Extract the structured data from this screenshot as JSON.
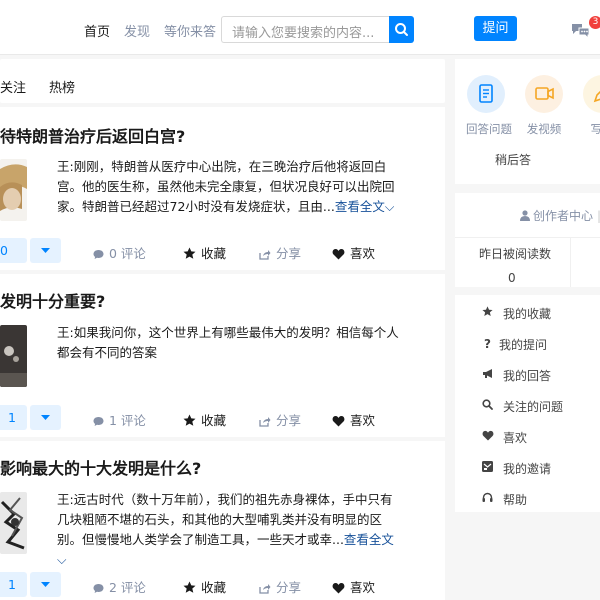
{
  "nav": {
    "links": [
      "首页",
      "发现",
      "等你来答"
    ],
    "search_placeholder": "请输入您要搜索的内容...",
    "ask_label": "提问",
    "message_count": "3"
  },
  "feed": {
    "tabs": [
      "关注",
      "热榜"
    ],
    "posts": [
      {
        "title": "待特朗普治疗后返回白宫?",
        "excerpt": "王:刚刚，特朗普从医疗中心出院，在三晚治疗后他将返回白宫。他的医生称，虽然他未完全康复，但状况良好可以出院回家。特朗普已经超过72小时没有发烧症状，且由...",
        "read_more": "查看全文",
        "vote": "0",
        "comments": "0 评论",
        "favorite": "收藏",
        "share": "分享",
        "like": "喜欢"
      },
      {
        "title": "发明十分重要?",
        "excerpt": "王:如果我问你，这个世界上有哪些最伟大的发明？相信每个人都会有不同的答案",
        "read_more": "",
        "vote": "1",
        "comments": "1 评论",
        "favorite": "收藏",
        "share": "分享",
        "like": "喜欢"
      },
      {
        "title": "影响最大的十大发明是什么?",
        "excerpt": "王:远古时代（数十万年前），我们的祖先赤身裸体，手中只有几块粗陋不堪的石头，和其他的大型哺乳类并没有明显的区别。但慢慢地人类学会了制造工具，一些天才或幸...",
        "read_more": "查看全文",
        "vote": "1",
        "comments": "2 评论",
        "favorite": "收藏",
        "share": "分享",
        "like": "喜欢"
      }
    ]
  },
  "sidebar": {
    "create": {
      "answer": "回答问题",
      "video": "发视频",
      "write": "写文",
      "later": "稍后答"
    },
    "creator": {
      "title": "创作者中心",
      "stat_label": "昨日被阅读数",
      "stat_value": "0"
    },
    "menu": [
      "我的收藏",
      "我的提问",
      "我的回答",
      "关注的问题",
      "喜欢",
      "我的邀请",
      "帮助"
    ]
  },
  "colors": {
    "accent": "#0084ff",
    "badge": "#f1403c",
    "link": "#175199"
  }
}
